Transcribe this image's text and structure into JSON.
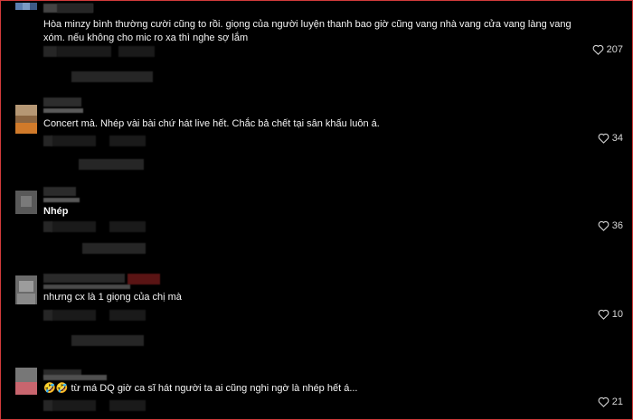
{
  "comments": [
    {
      "text": "Hòa minzy bình thường cười cũng to rồi. giọng của người luyện thanh bao giờ cũng vang nhà vang cửa vang làng vang xóm. nếu không cho mic ro xa thì nghe sợ lắm",
      "likes": "207"
    },
    {
      "text": "Concert mà. Nhép vài bài chứ hát live hết. Chắc bả chết tại sân khấu luôn á.",
      "likes": "34"
    },
    {
      "text": "Nhép",
      "likes": "36"
    },
    {
      "text": "nhưng cx là 1 giọng của chị mà",
      "likes": "10"
    },
    {
      "text": "🤣🤣 từ má DQ giờ ca sĩ hát người ta ai cũng nghi ngờ là nhép hết á...",
      "likes": "21"
    }
  ],
  "icons": {
    "like": "heart-outline-icon"
  },
  "colors": {
    "background": "#000000",
    "border": "#d13b3b",
    "text": "#f5f5f5"
  }
}
